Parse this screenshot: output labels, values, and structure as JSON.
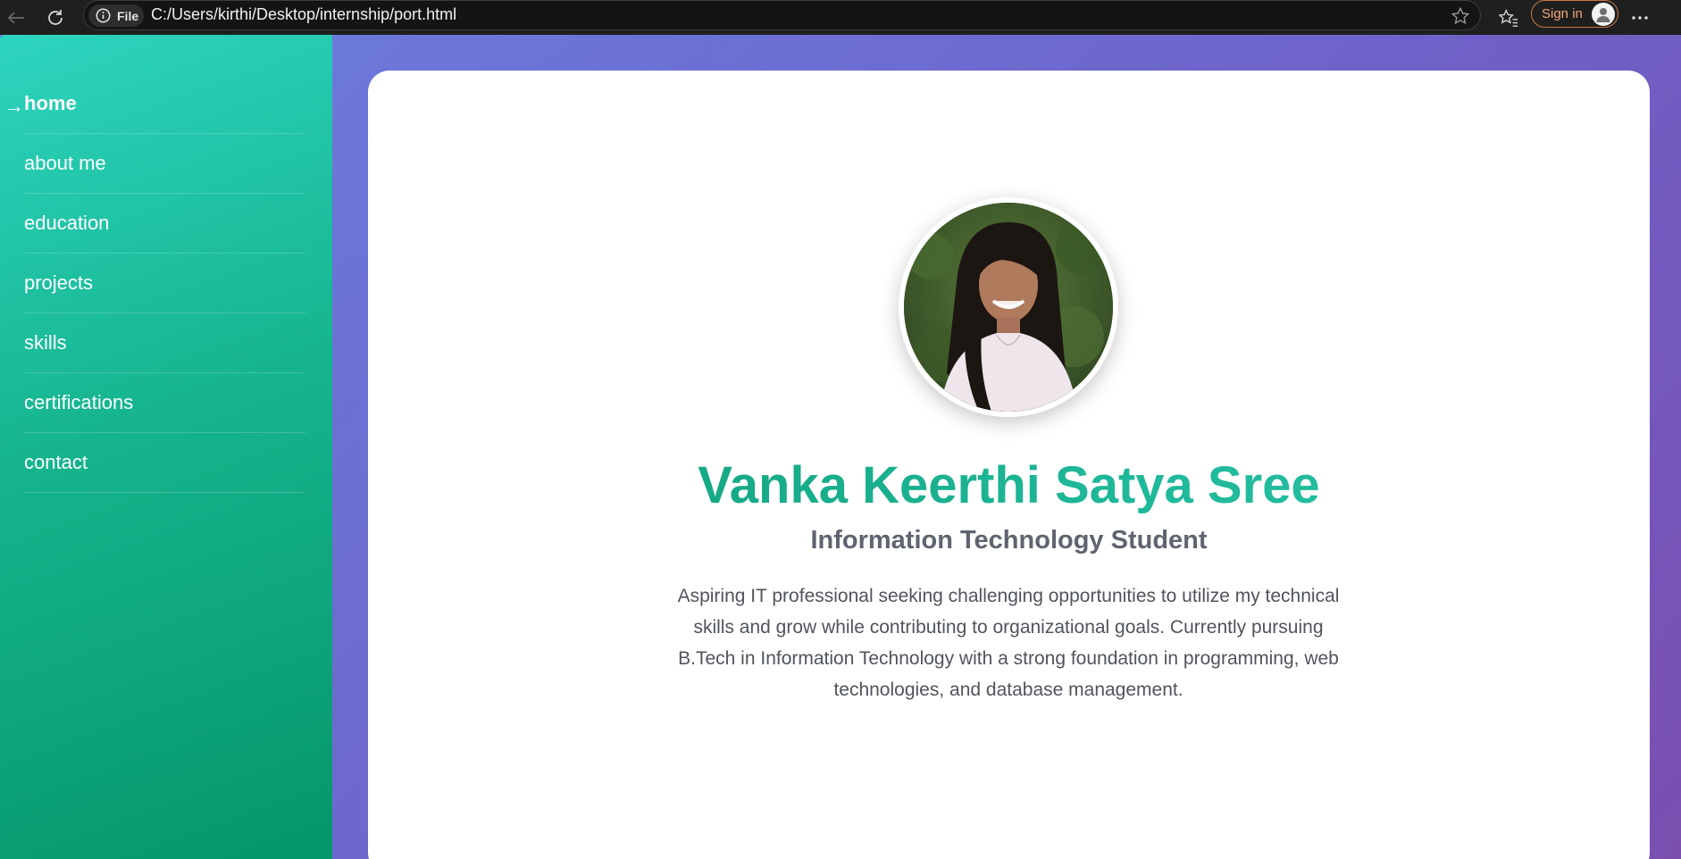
{
  "browser": {
    "file_chip_label": "File",
    "url": "C:/Users/kirthi/Desktop/internship/port.html",
    "sign_in_label": "Sign in",
    "icons": [
      "back-arrow-icon",
      "refresh-icon",
      "info-icon",
      "star-icon",
      "favorites-icon",
      "profile-icon",
      "more-icon"
    ]
  },
  "sidebar": {
    "active_marker": "→",
    "items": [
      {
        "label": "home",
        "active": true
      },
      {
        "label": "about me",
        "active": false
      },
      {
        "label": "education",
        "active": false
      },
      {
        "label": "projects",
        "active": false
      },
      {
        "label": "skills",
        "active": false
      },
      {
        "label": "certifications",
        "active": false
      },
      {
        "label": "contact",
        "active": false
      }
    ]
  },
  "hero": {
    "name": "Vanka Keerthi Satya Sree",
    "role": "Information Technology Student",
    "bio": "Aspiring IT professional seeking challenging opportunities to utilize my technical skills and grow while contributing to organizational goals. Currently pursuing B.Tech in Information Technology with a strong foundation in programming, web technologies, and database management."
  },
  "colors": {
    "sidebar_gradient_start": "#2dd4bf",
    "sidebar_gradient_end": "#059669",
    "background_gradient_start": "#6b7fe0",
    "background_gradient_end": "#7a4fb0",
    "name_accent": "#0f9e76",
    "signin_accent": "#f2a574"
  }
}
